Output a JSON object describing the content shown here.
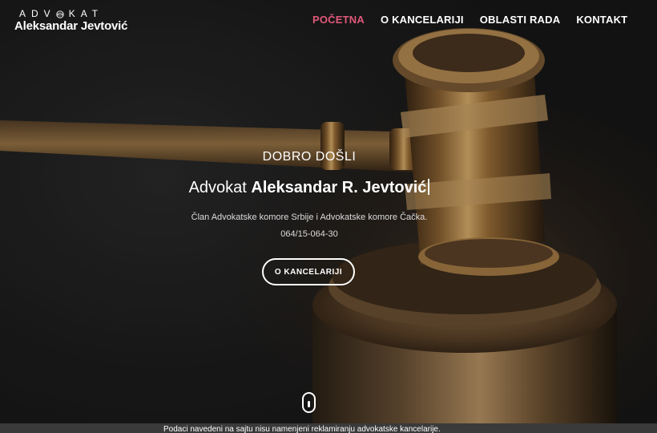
{
  "logo": {
    "top_text": "ADV",
    "top_text_after": "KAT",
    "name": "Aleksandar Jevtović"
  },
  "nav": {
    "items": [
      {
        "label": "POČETNA",
        "active": true
      },
      {
        "label": "O KANCELARIJI",
        "active": false
      },
      {
        "label": "OBLASTI RADA",
        "active": false
      },
      {
        "label": "KONTAKT",
        "active": false
      }
    ]
  },
  "hero": {
    "welcome": "DOBRO DOŠLI",
    "headline_prefix": "Advokat ",
    "headline_name": "Aleksandar R. Jevtović",
    "line1": "Član Advokatske komore Srbije i Advokatske komore Čačka.",
    "phone": "064/15-064-30",
    "cta_label": "O KANCELARIJI"
  },
  "footer": {
    "notice": "Podaci navedeni na sajtu nisu namenjeni reklamiranju advokatske kancelarije."
  },
  "colors": {
    "accent": "#e0587a",
    "text": "#ffffff"
  },
  "icons": {
    "scroll": "mouse-scroll-icon",
    "emblem": "scales-emblem-icon"
  }
}
